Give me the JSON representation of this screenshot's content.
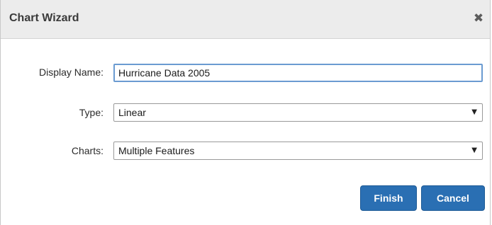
{
  "dialog": {
    "title": "Chart Wizard",
    "close_icon": "close-icon"
  },
  "form": {
    "display_name": {
      "label": "Display Name:",
      "value": "Hurricane Data 2005"
    },
    "type": {
      "label": "Type:",
      "selected": "Linear"
    },
    "charts": {
      "label": "Charts:",
      "selected": "Multiple Features"
    }
  },
  "buttons": {
    "finish_label": "Finish",
    "cancel_label": "Cancel"
  },
  "colors": {
    "accent": "#2a6fb3",
    "input_focus_border": "#6b9bd1",
    "titlebar_bg": "#ececec"
  }
}
